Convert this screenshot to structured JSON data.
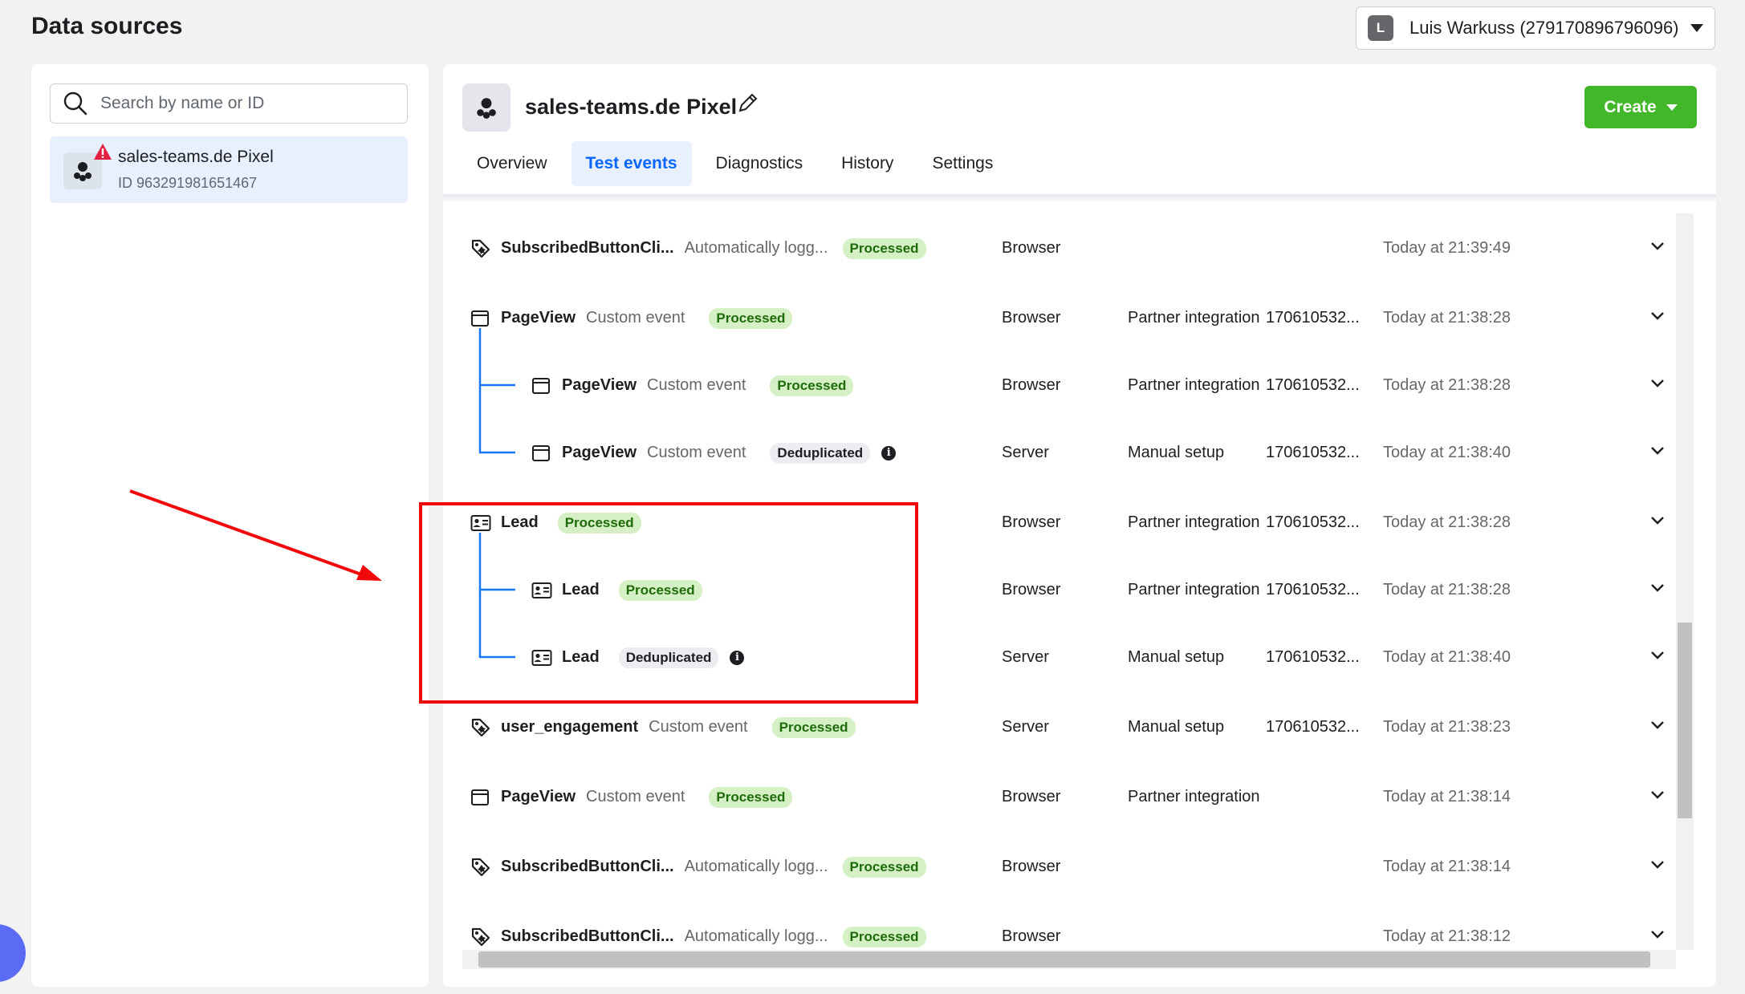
{
  "page": {
    "title": "Data sources"
  },
  "account": {
    "initial": "L",
    "name": "Luis Warkuss (279170896796096)"
  },
  "sidebar": {
    "search_placeholder": "Search by name or ID",
    "source": {
      "name": "sales-teams.de Pixel",
      "id": "ID 963291981651467"
    }
  },
  "main": {
    "pixel_name": "sales-teams.de Pixel",
    "create_label": "Create",
    "tabs": [
      {
        "label": "Overview"
      },
      {
        "label": "Test events"
      },
      {
        "label": "Diagnostics"
      },
      {
        "label": "History"
      },
      {
        "label": "Settings"
      }
    ]
  },
  "colors": {
    "accent": "#0866ff",
    "create": "#42b72a",
    "processed_bg": "#d4f0c4",
    "highlight": "#f0080a"
  },
  "events": [
    {
      "icon": "tag-icon",
      "name": "SubscribedButtonCli...",
      "type": "Automatically logg...",
      "status": "Processed",
      "source": "Browser",
      "integration": "",
      "event_id": "",
      "time": "Today at 21:39:49",
      "level": 0
    },
    {
      "icon": "browser-window-icon",
      "name": "PageView",
      "type": "Custom event",
      "status": "Processed",
      "source": "Browser",
      "integration": "Partner integration",
      "event_id": "170610532...",
      "time": "Today at 21:38:28",
      "level": 0
    },
    {
      "icon": "browser-window-icon",
      "name": "PageView",
      "type": "Custom event",
      "status": "Processed",
      "source": "Browser",
      "integration": "Partner integration",
      "event_id": "170610532...",
      "time": "Today at 21:38:28",
      "level": 1
    },
    {
      "icon": "browser-window-icon",
      "name": "PageView",
      "type": "Custom event",
      "status": "Deduplicated",
      "source": "Server",
      "integration": "Manual setup",
      "event_id": "170610532...",
      "time": "Today at 21:38:40",
      "level": 1
    },
    {
      "icon": "id-card-icon",
      "name": "Lead",
      "type": "",
      "status": "Processed",
      "source": "Browser",
      "integration": "Partner integration",
      "event_id": "170610532...",
      "time": "Today at 21:38:28",
      "level": 0
    },
    {
      "icon": "id-card-icon",
      "name": "Lead",
      "type": "",
      "status": "Processed",
      "source": "Browser",
      "integration": "Partner integration",
      "event_id": "170610532...",
      "time": "Today at 21:38:28",
      "level": 1
    },
    {
      "icon": "id-card-icon",
      "name": "Lead",
      "type": "",
      "status": "Deduplicated",
      "source": "Server",
      "integration": "Manual setup",
      "event_id": "170610532...",
      "time": "Today at 21:38:40",
      "level": 1
    },
    {
      "icon": "tag-icon",
      "name": "user_engagement",
      "type": "Custom event",
      "status": "Processed",
      "source": "Server",
      "integration": "Manual setup",
      "event_id": "170610532...",
      "time": "Today at 21:38:23",
      "level": 0
    },
    {
      "icon": "browser-window-icon",
      "name": "PageView",
      "type": "Custom event",
      "status": "Processed",
      "source": "Browser",
      "integration": "Partner integration",
      "event_id": "",
      "time": "Today at 21:38:14",
      "level": 0
    },
    {
      "icon": "tag-icon",
      "name": "SubscribedButtonCli...",
      "type": "Automatically logg...",
      "status": "Processed",
      "source": "Browser",
      "integration": "",
      "event_id": "",
      "time": "Today at 21:38:14",
      "level": 0
    },
    {
      "icon": "tag-icon",
      "name": "SubscribedButtonCli...",
      "type": "Automatically logg...",
      "status": "Processed",
      "source": "Browser",
      "integration": "",
      "event_id": "",
      "time": "Today at 21:38:12",
      "level": 0
    }
  ]
}
